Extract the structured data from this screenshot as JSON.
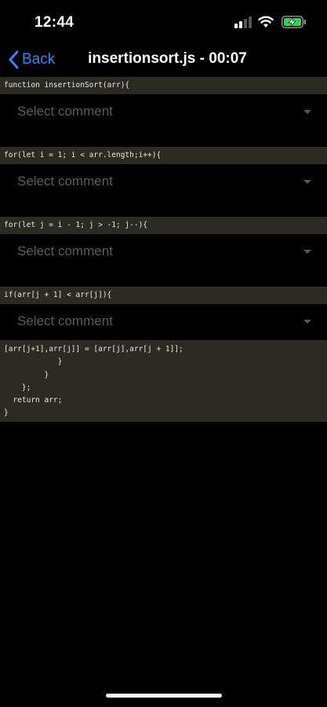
{
  "status": {
    "time": "12:44"
  },
  "nav": {
    "back_label": "Back",
    "title": "insertionsort.js - 00:07"
  },
  "code_lines": [
    "function insertionSort(arr){",
    "for(let i = 1; i < arr.length;i++){",
    "for(let j = i - 1; j > -1; j--){",
    "if(arr[j + 1] < arr[j]){"
  ],
  "select_placeholder": "Select comment",
  "code_tail": [
    "[arr[j+1],arr[j]] = [arr[j],arr[j + 1]];",
    "            }",
    "         }",
    "    };",
    "  return arr;",
    "}"
  ],
  "colors": {
    "accent": "#3b82f6",
    "code_bg": "#2b2b24",
    "placeholder": "#5b5b5b"
  }
}
